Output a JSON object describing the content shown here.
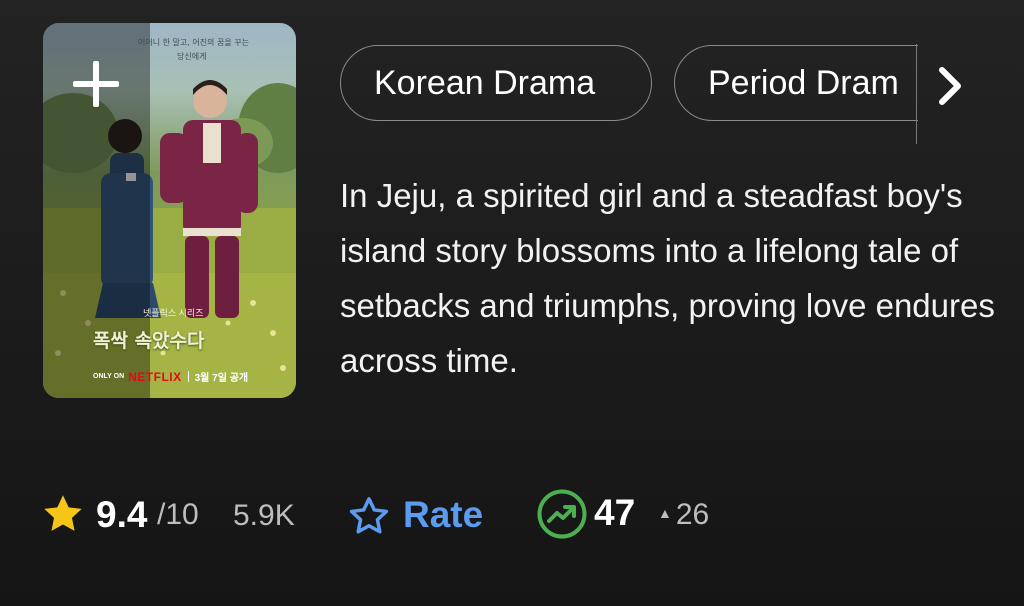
{
  "poster": {
    "title_korean": "폭싹 속았수다",
    "subtitle_korean": "넷플릭스 시리즈",
    "tagline_korean_line1": "어머니 한 말고, 어진의 꿈을 꾸는",
    "tagline_korean_line2": "당신에게",
    "only_on": "ONLY ON",
    "netflix": "NETFLIX",
    "release": "3월 7일 공개",
    "add_icon": "plus-icon"
  },
  "genres": [
    {
      "label": "Korean Drama"
    },
    {
      "label": "Period Dram"
    }
  ],
  "more_genres_icon": "chevron-right-icon",
  "plot": "In Jeju, a spirited girl and a steadfast boy's island story blossoms into a lifelong tale of setbacks and triumphs, proving love endures across time.",
  "rating": {
    "score": "9.4",
    "out_of": "/10",
    "votes": "5.9K",
    "star_icon": "star-icon",
    "star_color": "#f5c518"
  },
  "rate": {
    "label": "Rate",
    "icon": "star-outline-icon",
    "color": "#5b9bf0"
  },
  "popularity": {
    "rank": "47",
    "change": "26",
    "icon": "trending-up-icon",
    "icon_color": "#4caf50"
  }
}
